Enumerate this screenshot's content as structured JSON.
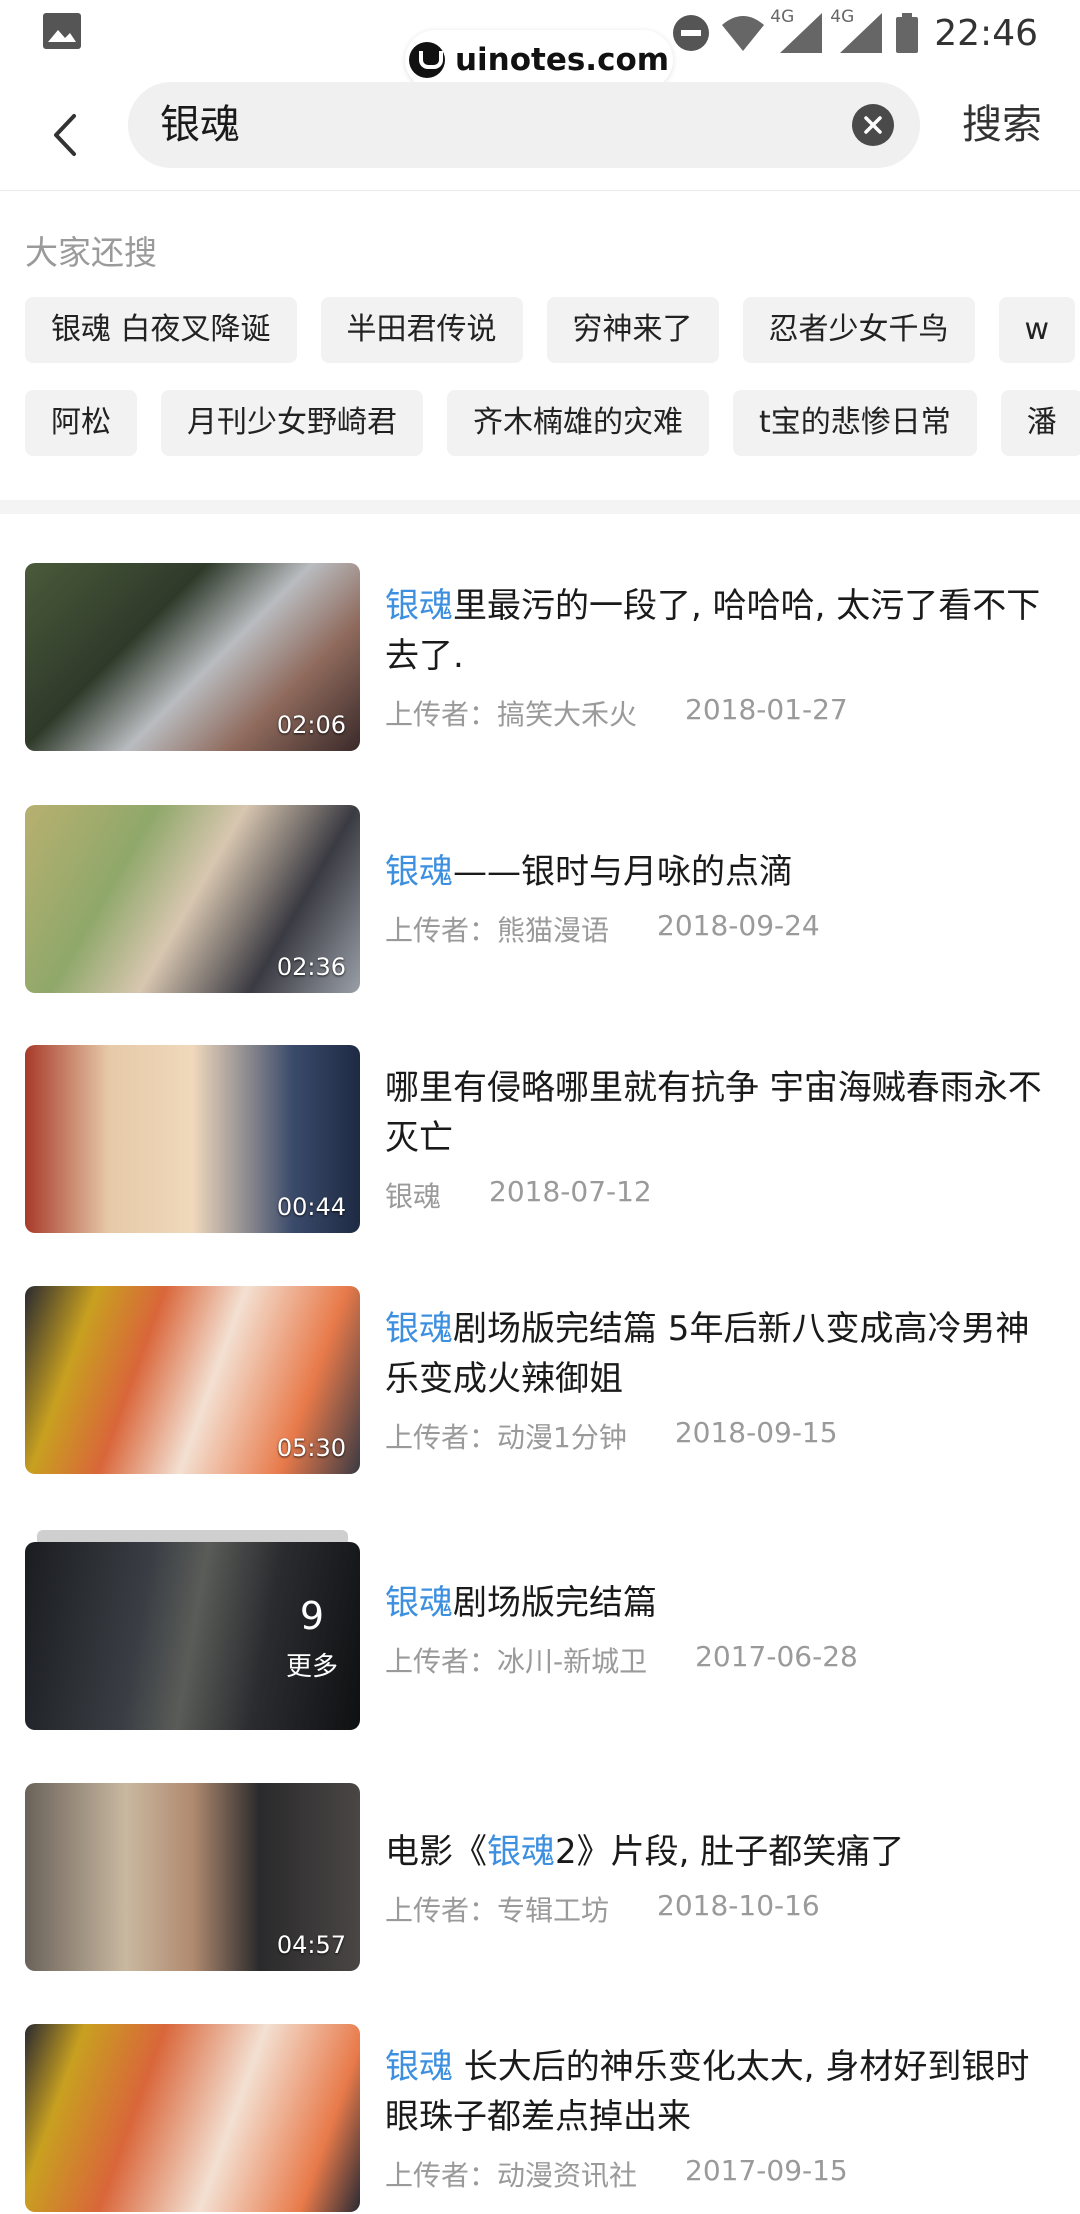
{
  "status_bar": {
    "time": "22:46",
    "network_1": "4G",
    "network_2": "4G"
  },
  "watermark": "uinotes.com",
  "search": {
    "query": "银魂",
    "submit_label": "搜索"
  },
  "suggestions": {
    "title": "大家还搜",
    "row1": [
      "银魂 白夜叉降诞",
      "半田君传说",
      "穷神来了",
      "忍者少女千鸟",
      "w"
    ],
    "row2": [
      "阿松",
      "月刊少女野崎君",
      "齐木楠雄的灾难",
      "t宝的悲惨日常",
      "潘"
    ]
  },
  "videos": [
    {
      "title_hl": "银魂",
      "title_rest": "里最污的一段了, 哈哈哈, 太污了看不下去了.",
      "uploader": "上传者：搞笑大禾火",
      "date": "2018-01-27",
      "duration": "02:06"
    },
    {
      "title_hl": "银魂",
      "title_rest": "——银时与月咏的点滴",
      "uploader": "上传者：熊猫漫语",
      "date": "2018-09-24",
      "duration": "02:36"
    },
    {
      "title_hl": "",
      "title_rest": "哪里有侵略哪里就有抗争 宇宙海贼春雨永不灭亡",
      "uploader": "银魂",
      "date": "2018-07-12",
      "duration": "00:44"
    },
    {
      "title_hl": "银魂",
      "title_rest": "剧场版完结篇 5年后新八变成高冷男神乐变成火辣御姐",
      "uploader": "上传者：动漫1分钟",
      "date": "2018-09-15",
      "duration": "05:30"
    },
    {
      "title_hl": "银魂",
      "title_rest": "剧场版完结篇",
      "uploader": "上传者：冰川-新城卫",
      "date": "2017-06-28",
      "more_count": "9",
      "more_label": "更多"
    },
    {
      "title_pre": "电影《",
      "title_hl": "银魂",
      "title_rest": "2》片段, 肚子都笑痛了",
      "uploader": "上传者：专辑工坊",
      "date": "2018-10-16",
      "duration": "04:57"
    },
    {
      "title_hl": "银魂",
      "title_rest": " 长大后的神乐变化太大, 身材好到银时眼珠子都差点掉出来",
      "uploader": "上传者：动漫资讯社",
      "date": "2017-09-15"
    }
  ],
  "colors": {
    "highlight": "#3d8fe0",
    "meta_text": "#9a9a9a",
    "chip_bg": "#f2f2f2",
    "search_bg": "#f0f0f0"
  }
}
